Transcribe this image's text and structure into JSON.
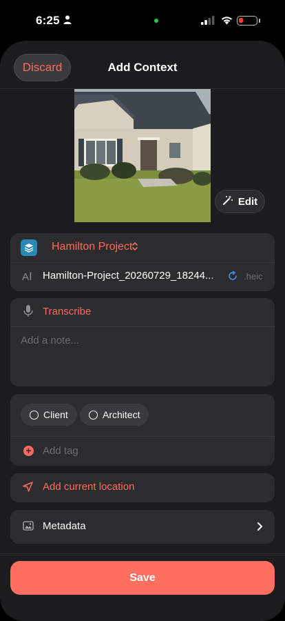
{
  "status_bar": {
    "time": "6:25"
  },
  "nav": {
    "discard_label": "Discard",
    "title": "Add Context"
  },
  "photo": {
    "edit_label": "Edit"
  },
  "project": {
    "name": "Hamilton Project",
    "filename": "Hamilton-Project_20260729_18244...",
    "extension": ".heic"
  },
  "note": {
    "transcribe_label": "Transcribe",
    "placeholder": "Add a note..."
  },
  "tags": {
    "items": [
      "Client",
      "Architect"
    ],
    "add_placeholder": "Add tag"
  },
  "location": {
    "label": "Add current location"
  },
  "metadata": {
    "label": "Metadata"
  },
  "footer": {
    "save_label": "Save"
  },
  "colors": {
    "accent": "#ff6b5e",
    "background": "#1c1c1e",
    "card": "#2c2c2e"
  },
  "icons": [
    "person-icon",
    "signal-icon",
    "wifi-icon",
    "battery-icon",
    "wand-icon",
    "layers-icon",
    "chevrons-updown-icon",
    "text-cursor-icon",
    "refresh-icon",
    "mic-icon",
    "plus-circle-icon",
    "location-arrow-icon",
    "photo-metadata-icon",
    "chevron-right-icon"
  ]
}
